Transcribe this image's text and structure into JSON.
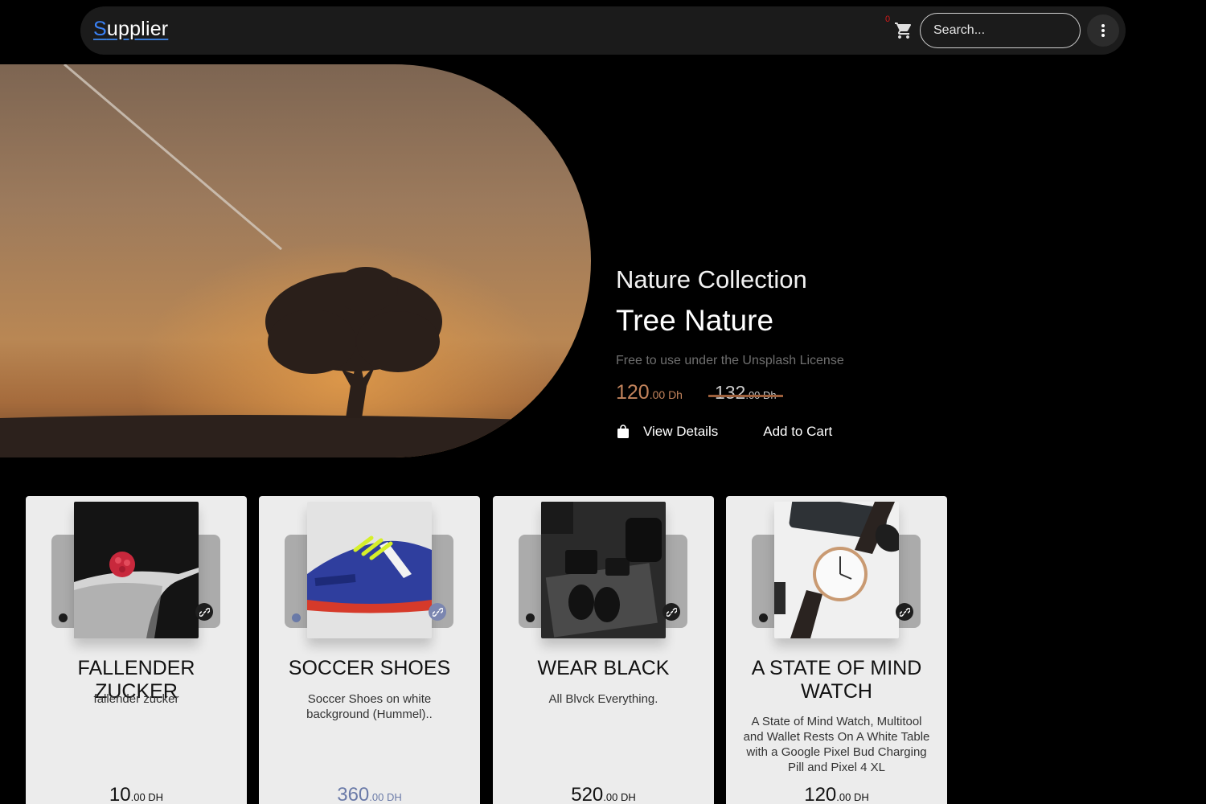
{
  "navbar": {
    "brand_first": "S",
    "brand_rest": "upplier",
    "cart_count": "0",
    "cart_icon": "shopping-cart-icon",
    "search_placeholder": "Search...",
    "menu_icon": "kebab-menu-icon"
  },
  "hero": {
    "collection": "Nature Collection",
    "title": "Tree Nature",
    "license": "Free to use under the Unsplash License",
    "price_now_int": "120",
    "price_now_dec": ".00 Dh",
    "price_old_int": "132",
    "price_old_dec": ".00 Dh",
    "view_details": "View Details",
    "add_to_cart": "Add to Cart",
    "bag_icon": "shopping-bag-icon"
  },
  "products": [
    {
      "name": "FALLENDER ZUCKER",
      "description": "fallender zucker",
      "price_int": "10",
      "price_dec": ".00 DH",
      "link_icon": "link-icon"
    },
    {
      "name": "SOCCER SHOES",
      "description": "Soccer Shoes on white background (Hummel)..",
      "price_int": "360",
      "price_dec": ".00 DH",
      "link_icon": "link-icon"
    },
    {
      "name": "WEAR BLACK",
      "description": "All Blvck Everything.",
      "price_int": "520",
      "price_dec": ".00 DH",
      "link_icon": "link-icon"
    },
    {
      "name": "A STATE OF MIND WATCH",
      "description": "A State of Mind Watch, Multitool and Wallet Rests On A White Table with a Google Pixel Bud Charging Pill and Pixel 4 XL",
      "price_int": "120",
      "price_dec": ".00 DH",
      "link_icon": "link-icon"
    }
  ],
  "colors": {
    "accent_blue": "#3a82f7",
    "price_brown": "#c2835c",
    "cart_badge": "#d21a1a",
    "card_bg": "#ececec"
  }
}
